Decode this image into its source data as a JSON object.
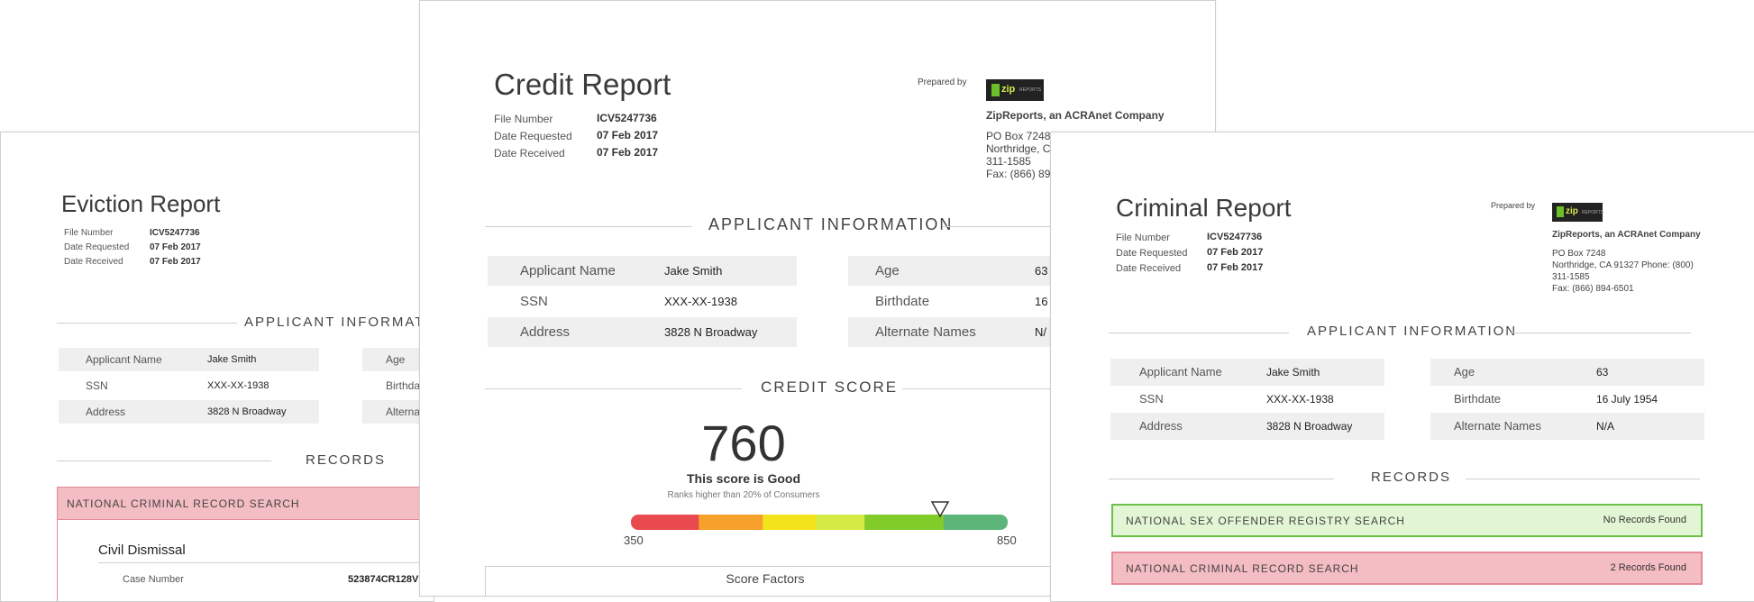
{
  "eviction": {
    "title": "Eviction Report",
    "meta": [
      {
        "label": "File Number",
        "value": "ICV5247736"
      },
      {
        "label": "Date Requested",
        "value": "07 Feb 2017"
      },
      {
        "label": "Date Received",
        "value": "07 Feb 2017"
      }
    ],
    "applicant_heading": "APPLICANT INFORMATION",
    "left_rows": [
      {
        "label": "Applicant Name",
        "value": "Jake Smith"
      },
      {
        "label": "SSN",
        "value": "XXX-XX-1938"
      },
      {
        "label": "Address",
        "value": "3828 N Broadway"
      }
    ],
    "right_labels": [
      "Age",
      "Birthdate",
      "Alternate Names"
    ],
    "records_heading": "RECORDS",
    "record_bar": "NATIONAL CRIMINAL RECORD SEARCH",
    "subheading": "Civil Dismissal",
    "case_label": "Case Number",
    "case_value": "523874CR128V"
  },
  "credit": {
    "title": "Credit Report",
    "meta": [
      {
        "label": "File Number",
        "value": "ICV5247736"
      },
      {
        "label": "Date Requested",
        "value": "07 Feb 2017"
      },
      {
        "label": "Date Received",
        "value": "07 Feb 2017"
      }
    ],
    "prepared_by": "Prepared by",
    "logo_text": "zip",
    "logo_sub": "REPORTS",
    "company": "ZipReports, an ACRAnet Company",
    "address_lines": [
      "PO Box 7248",
      "Northridge, C",
      "311-1585",
      "Fax: (866) 89"
    ],
    "applicant_heading": "APPLICANT INFORMATION",
    "left_rows": [
      {
        "label": "Applicant Name",
        "value": "Jake Smith"
      },
      {
        "label": "SSN",
        "value": "XXX-XX-1938"
      },
      {
        "label": "Address",
        "value": "3828 N Broadway"
      }
    ],
    "right_rows": [
      {
        "label": "Age",
        "value": "63"
      },
      {
        "label": "Birthdate",
        "value": "16"
      },
      {
        "label": "Alternate Names",
        "value": "N/"
      }
    ],
    "score_heading": "CREDIT SCORE",
    "score": "760",
    "score_text": "This score is Good",
    "score_rank": "Ranks higher than 20% of Consumers",
    "scale_min": "350",
    "scale_max": "850",
    "score_fraction": 0.82,
    "gauge_colors": [
      "#e84a4f",
      "#f5a12a",
      "#f3e31c",
      "#d6ea44",
      "#82cc2a",
      "#5eb57a"
    ],
    "factors_label": "Score Factors"
  },
  "criminal": {
    "title": "Criminal Report",
    "meta": [
      {
        "label": "File Number",
        "value": "ICV5247736"
      },
      {
        "label": "Date Requested",
        "value": "07 Feb 2017"
      },
      {
        "label": "Date Received",
        "value": "07 Feb 2017"
      }
    ],
    "prepared_by": "Prepared by",
    "logo_text": "zip",
    "logo_sub": "REPORTS",
    "company": "ZipReports, an ACRAnet Company",
    "address_lines": [
      "PO Box 7248",
      "Northridge, CA 91327 Phone: (800)",
      "311-1585",
      "Fax: (866) 894-6501"
    ],
    "applicant_heading": "APPLICANT INFORMATION",
    "left_rows": [
      {
        "label": "Applicant Name",
        "value": "Jake Smith"
      },
      {
        "label": "SSN",
        "value": "XXX-XX-1938"
      },
      {
        "label": "Address",
        "value": "3828 N Broadway"
      }
    ],
    "right_rows": [
      {
        "label": "Age",
        "value": "63"
      },
      {
        "label": "Birthdate",
        "value": "16 July 1954"
      },
      {
        "label": "Alternate Names",
        "value": "N/A"
      }
    ],
    "records_heading": "RECORDS",
    "records": [
      {
        "name": "NATIONAL SEX OFFENDER REGISTRY SEARCH",
        "status": "No Records Found"
      },
      {
        "name": "NATIONAL CRIMINAL RECORD SEARCH",
        "status": "2 Records Found"
      }
    ]
  },
  "colors": {
    "green_bar_bg": "#e2f5d4",
    "green_bar_border": "#6cc04a",
    "red_bar_bg": "#f4bcc3",
    "red_bar_border": "#e58a96"
  }
}
